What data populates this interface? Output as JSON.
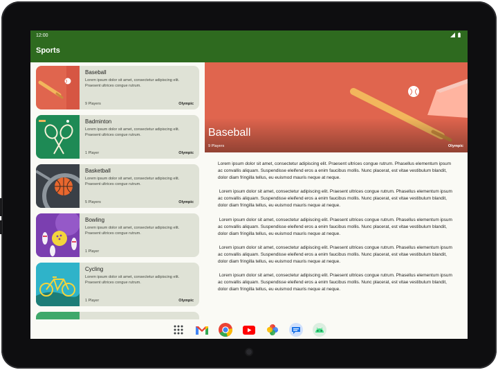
{
  "status_bar": {
    "time": "12:00"
  },
  "app_bar": {
    "title": "Sports"
  },
  "sports": [
    {
      "title": "Baseball",
      "description": "Lorem ipsum dolor sit amet, consectetur adipiscing elit. Praesent ultrices congue rutrum.",
      "players": "9 Players",
      "olympic": "Olympic"
    },
    {
      "title": "Badminton",
      "description": "Lorem ipsum dolor sit amet, consectetur adipiscing elit. Praesent ultrices congue rutrum.",
      "players": "1 Player",
      "olympic": "Olympic"
    },
    {
      "title": "Basketball",
      "description": "Lorem ipsum dolor sit amet, consectetur adipiscing elit. Praesent ultrices congue rutrum.",
      "players": "5 Players",
      "olympic": "Olympic"
    },
    {
      "title": "Bowling",
      "description": "Lorem ipsum dolor sit amet, consectetur adipiscing elit. Praesent ultrices congue rutrum.",
      "players": "1 Player",
      "olympic": ""
    },
    {
      "title": "Cycling",
      "description": "Lorem ipsum dolor sit amet, consectetur adipiscing elit. Praesent ultrices congue rutrum.",
      "players": "1 Player",
      "olympic": "Olympic"
    }
  ],
  "detail": {
    "title": "Baseball",
    "players": "9 Players",
    "olympic": "Olympic",
    "paragraphs": [
      "Lorem ipsum dolor sit amet, consectetur adipiscing elit. Praesent ultrices congue rutrum. Phasellus elementum ipsum ac convallis aliquam. Suspendisse eleifend eros a enim faucibus mollis. Nunc placerat, est vitae vestibulum blandit, dolor diam fringilla tellus, eu euismod mauris neque at neque.",
      " Lorem ipsum dolor sit amet, consectetur adipiscing elit. Praesent ultrices congue rutrum. Phasellus elementum ipsum ac convallis aliquam. Suspendisse eleifend eros a enim faucibus mollis. Nunc placerat, est vitae vestibulum blandit, dolor diam fringilla tellus, eu euismod mauris neque at neque.",
      " Lorem ipsum dolor sit amet, consectetur adipiscing elit. Praesent ultrices congue rutrum. Phasellus elementum ipsum ac convallis aliquam. Suspendisse eleifend eros a enim faucibus mollis. Nunc placerat, est vitae vestibulum blandit, dolor diam fringilla tellus, eu euismod mauris neque at neque.",
      " Lorem ipsum dolor sit amet, consectetur adipiscing elit. Praesent ultrices congue rutrum. Phasellus elementum ipsum ac convallis aliquam. Suspendisse eleifend eros a enim faucibus mollis. Nunc placerat, est vitae vestibulum blandit, dolor diam fringilla tellus, eu euismod mauris neque at neque.",
      " Lorem ipsum dolor sit amet, consectetur adipiscing elit. Praesent ultrices congue rutrum. Phasellus elementum ipsum ac convallis aliquam. Suspendisse eleifend eros a enim faucibus mollis. Nunc placerat, est vitae vestibulum blandit, dolor diam fringilla tellus, eu euismod mauris neque at neque."
    ]
  },
  "dock": [
    "app-drawer-icon",
    "gmail-icon",
    "chrome-icon",
    "youtube-icon",
    "photos-icon",
    "messages-icon",
    "android-icon"
  ],
  "colors": {
    "app_bar": "#2e6a1f",
    "card": "#dfe2d6",
    "hero": "#e0654e",
    "background": "#fafaf5"
  }
}
